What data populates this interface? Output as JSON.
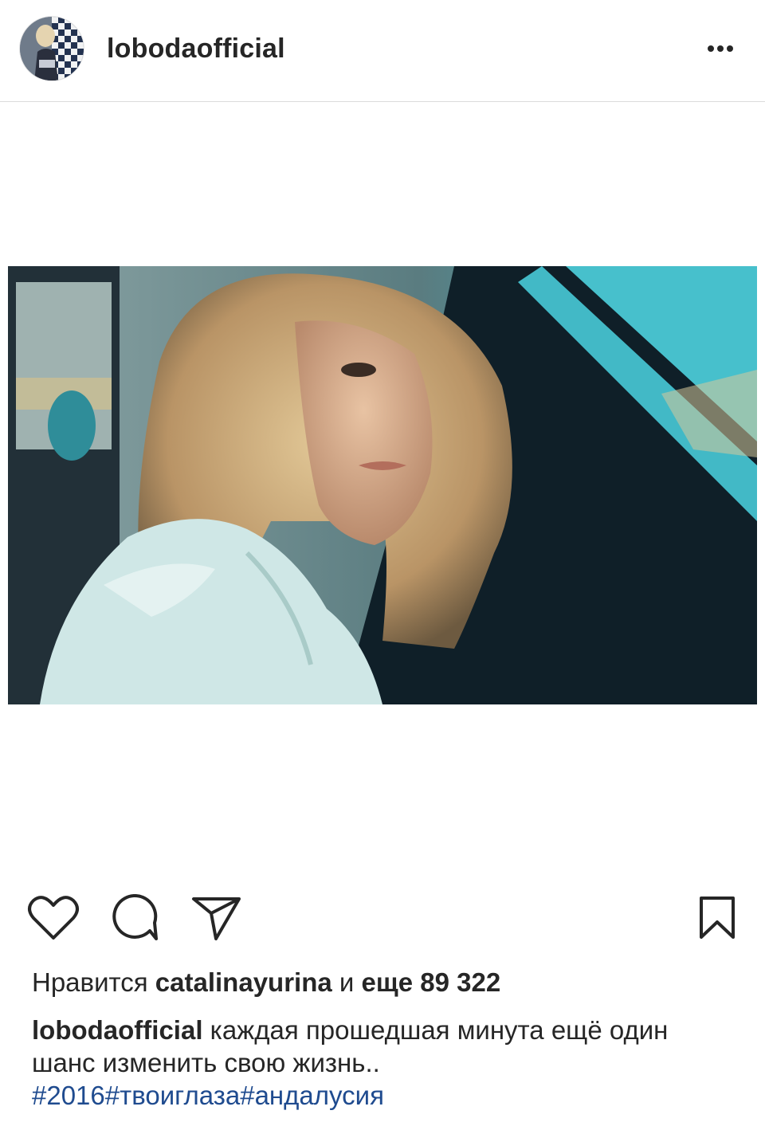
{
  "post": {
    "username": "lobodaofficial",
    "avatar_icon": "profile-avatar",
    "more_icon": "more-options-icon"
  },
  "image": {
    "description_palette": {
      "sky": "#3fb6c4",
      "hair": "#c9a87a",
      "shirt": "#cfe7e6",
      "dark": "#10212a"
    }
  },
  "actions": {
    "like_icon": "heart-icon",
    "comment_icon": "comment-icon",
    "share_icon": "paper-plane-icon",
    "save_icon": "bookmark-icon"
  },
  "likes": {
    "prefix": "Нравится ",
    "user": "catalinayurina",
    "middle": " и ",
    "count_text": "еще 89 322"
  },
  "caption": {
    "user": "lobodaofficial",
    "text": " каждая прошедшая минута ещё один шанс изменить свою жизнь..",
    "hashtags": [
      "#2016",
      "#твоиглаза",
      "#андалусия"
    ]
  }
}
